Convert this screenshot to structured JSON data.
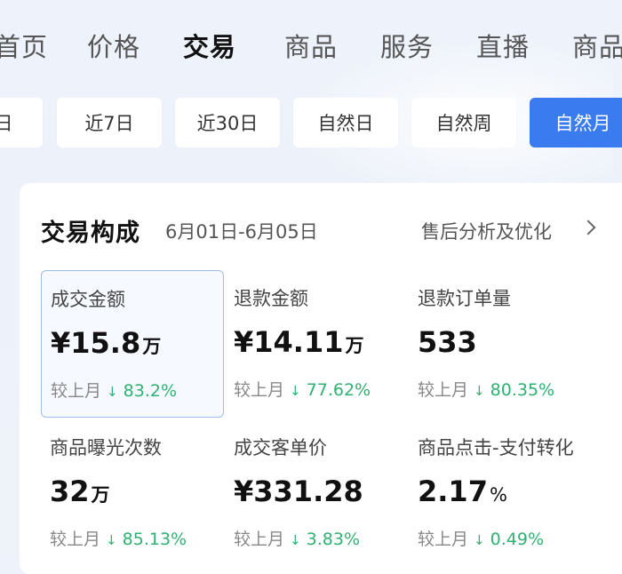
{
  "nav": {
    "tabs": [
      {
        "label": "首页",
        "active": false
      },
      {
        "label": "价格",
        "active": false
      },
      {
        "label": "交易",
        "active": true
      },
      {
        "label": "商品",
        "active": false
      },
      {
        "label": "服务",
        "active": false
      },
      {
        "label": "直播",
        "active": false
      },
      {
        "label": "商品",
        "active": false
      }
    ]
  },
  "date_range": {
    "options": [
      {
        "label": "日",
        "active": false
      },
      {
        "label": "近7日",
        "active": false
      },
      {
        "label": "近30日",
        "active": false
      },
      {
        "label": "自然日",
        "active": false
      },
      {
        "label": "自然周",
        "active": false
      },
      {
        "label": "自然月",
        "active": true
      }
    ]
  },
  "card": {
    "title": "交易构成",
    "date": "6月01日-6月05日",
    "link": "售后分析及优化",
    "compare_label": "较上月",
    "metrics": [
      {
        "label": "成交金额",
        "value": "¥15.8",
        "unit": "万",
        "change": "83.2%",
        "direction": "down",
        "selected": true
      },
      {
        "label": "退款金额",
        "value": "¥14.11",
        "unit": "万",
        "change": "77.62%",
        "direction": "down",
        "selected": false
      },
      {
        "label": "退款订单量",
        "value": "533",
        "unit": "",
        "change": "80.35%",
        "direction": "down",
        "selected": false
      },
      {
        "label": "商品曝光次数",
        "value": "32",
        "unit": "万",
        "change": "85.13%",
        "direction": "down",
        "selected": false
      },
      {
        "label": "成交客单价",
        "value": "¥331.28",
        "unit": "",
        "change": "3.83%",
        "direction": "down",
        "selected": false
      },
      {
        "label": "商品点击-支付转化",
        "value": "2.17",
        "unit": "%",
        "change": "0.49%",
        "direction": "down",
        "selected": false
      }
    ]
  },
  "colors": {
    "accent": "#3b7bf0",
    "decrease": "#2fb171",
    "background": "#eef3fb"
  }
}
